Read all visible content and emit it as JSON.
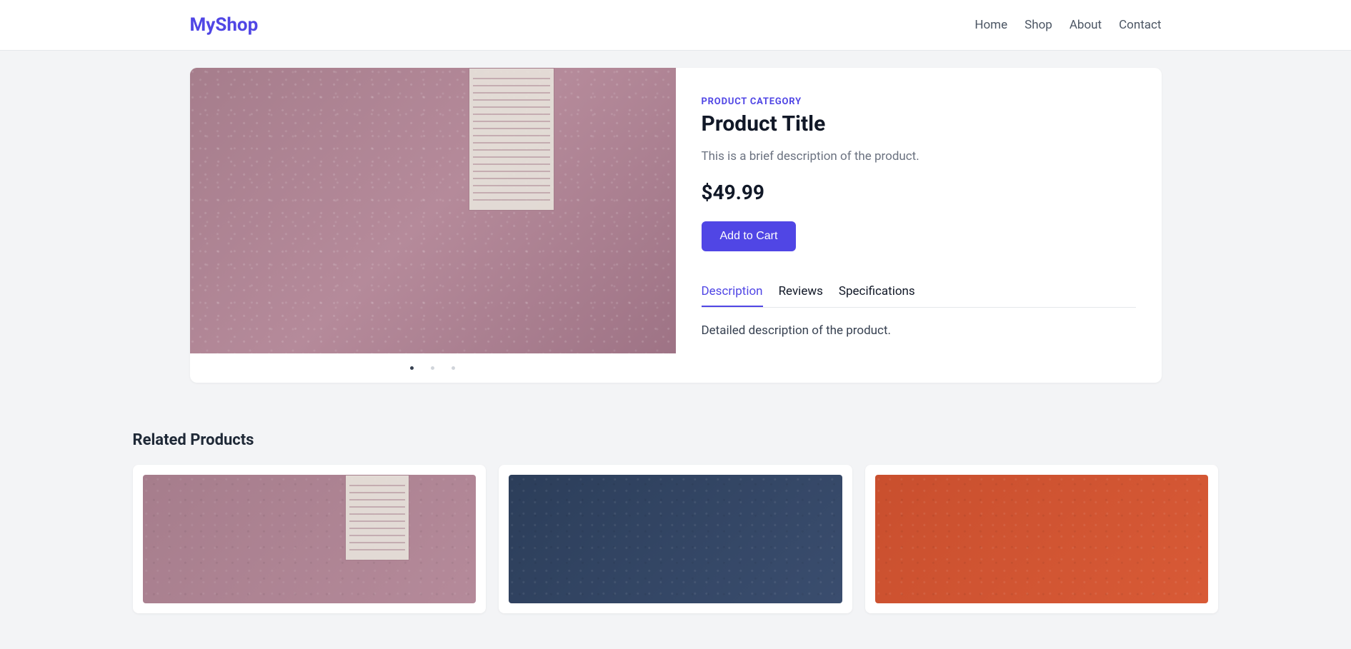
{
  "header": {
    "logo": "MyShop",
    "nav": {
      "home": "Home",
      "shop": "Shop",
      "about": "About",
      "contact": "Contact"
    }
  },
  "product": {
    "category": "PRODUCT CATEGORY",
    "title": "Product Title",
    "description": "This is a brief description of the product.",
    "price": "$49.99",
    "add_to_cart": "Add to Cart",
    "tabs": {
      "description": "Description",
      "reviews": "Reviews",
      "specifications": "Specifications"
    },
    "tab_content": "Detailed description of the product."
  },
  "related": {
    "title": "Related Products"
  }
}
